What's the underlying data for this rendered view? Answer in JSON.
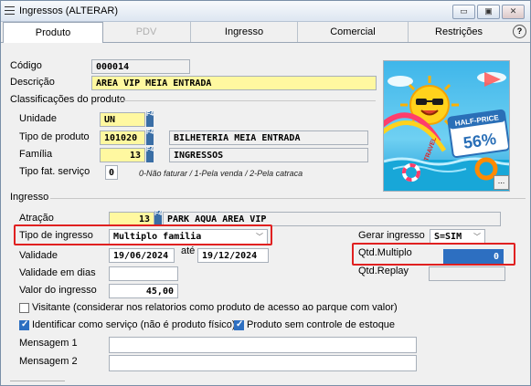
{
  "window": {
    "title": "Ingressos (ALTERAR)"
  },
  "tabs": [
    {
      "label": "Produto"
    },
    {
      "label": "PDV"
    },
    {
      "label": "Ingresso"
    },
    {
      "label": "Comercial"
    },
    {
      "label": "Restrições"
    }
  ],
  "help_label": "?",
  "produto": {
    "codigo_label": "Código",
    "codigo_value": "000014",
    "descricao_label": "Descrição",
    "descricao_value": "AREA VIP MEIA ENTRADA",
    "classificacoes_label": "Classificações do produto",
    "unidade_label": "Unidade",
    "unidade_value": "UN",
    "tipo_produto_label": "Tipo de produto",
    "tipo_produto_code": "101020",
    "tipo_produto_desc": "BILHETERIA MEIA ENTRADA",
    "familia_label": "Família",
    "familia_code": "13",
    "familia_desc": "INGRESSOS",
    "tipo_fat_label": "Tipo fat. serviço",
    "tipo_fat_value": "0",
    "tipo_fat_hint": "0-Não faturar / 1-Pela venda / 2-Pela catraca",
    "f4_label": "F4"
  },
  "image": {
    "banner_text": "HALF-PRICE",
    "percent_text": "56%",
    "side_text": "TRAVEL",
    "more_button": "..."
  },
  "ingresso": {
    "section_label": "Ingresso",
    "atracao_label": "Atração",
    "atracao_code": "13",
    "atracao_desc": "PARK AQUA AREA VIP",
    "tipo_ingresso_label": "Tipo de ingresso",
    "tipo_ingresso_value": "Multiplo familia",
    "gerar_ingresso_label": "Gerar ingresso",
    "gerar_ingresso_value": "S=SIM",
    "validade_label": "Validade",
    "validade_de": "19/06/2024",
    "ate_label": "até",
    "validade_ate": "19/12/2024",
    "qtd_multiplo_label": "Qtd.Multiplo",
    "qtd_multiplo_value": "0",
    "validade_dias_label": "Validade em dias",
    "validade_dias_value": "",
    "qtd_replay_label": "Qtd.Replay",
    "qtd_replay_value": "",
    "valor_label": "Valor do ingresso",
    "valor_value": "45,00",
    "visitante_label": "Visitante (considerar nos relatorios como produto de acesso ao parque com valor)",
    "visitante_checked": false,
    "identificar_label": "Identificar como serviço (não é produto físico)",
    "identificar_checked": true,
    "sem_estoque_label": "Produto sem controle de estoque",
    "sem_estoque_checked": true,
    "mensagem1_label": "Mensagem 1",
    "mensagem1_value": "",
    "mensagem2_label": "Mensagem 2",
    "mensagem2_value": ""
  },
  "colors": {
    "highlight_red": "#e02020",
    "field_yellow": "#fff8a0",
    "selection_blue": "#2d6fc1"
  }
}
